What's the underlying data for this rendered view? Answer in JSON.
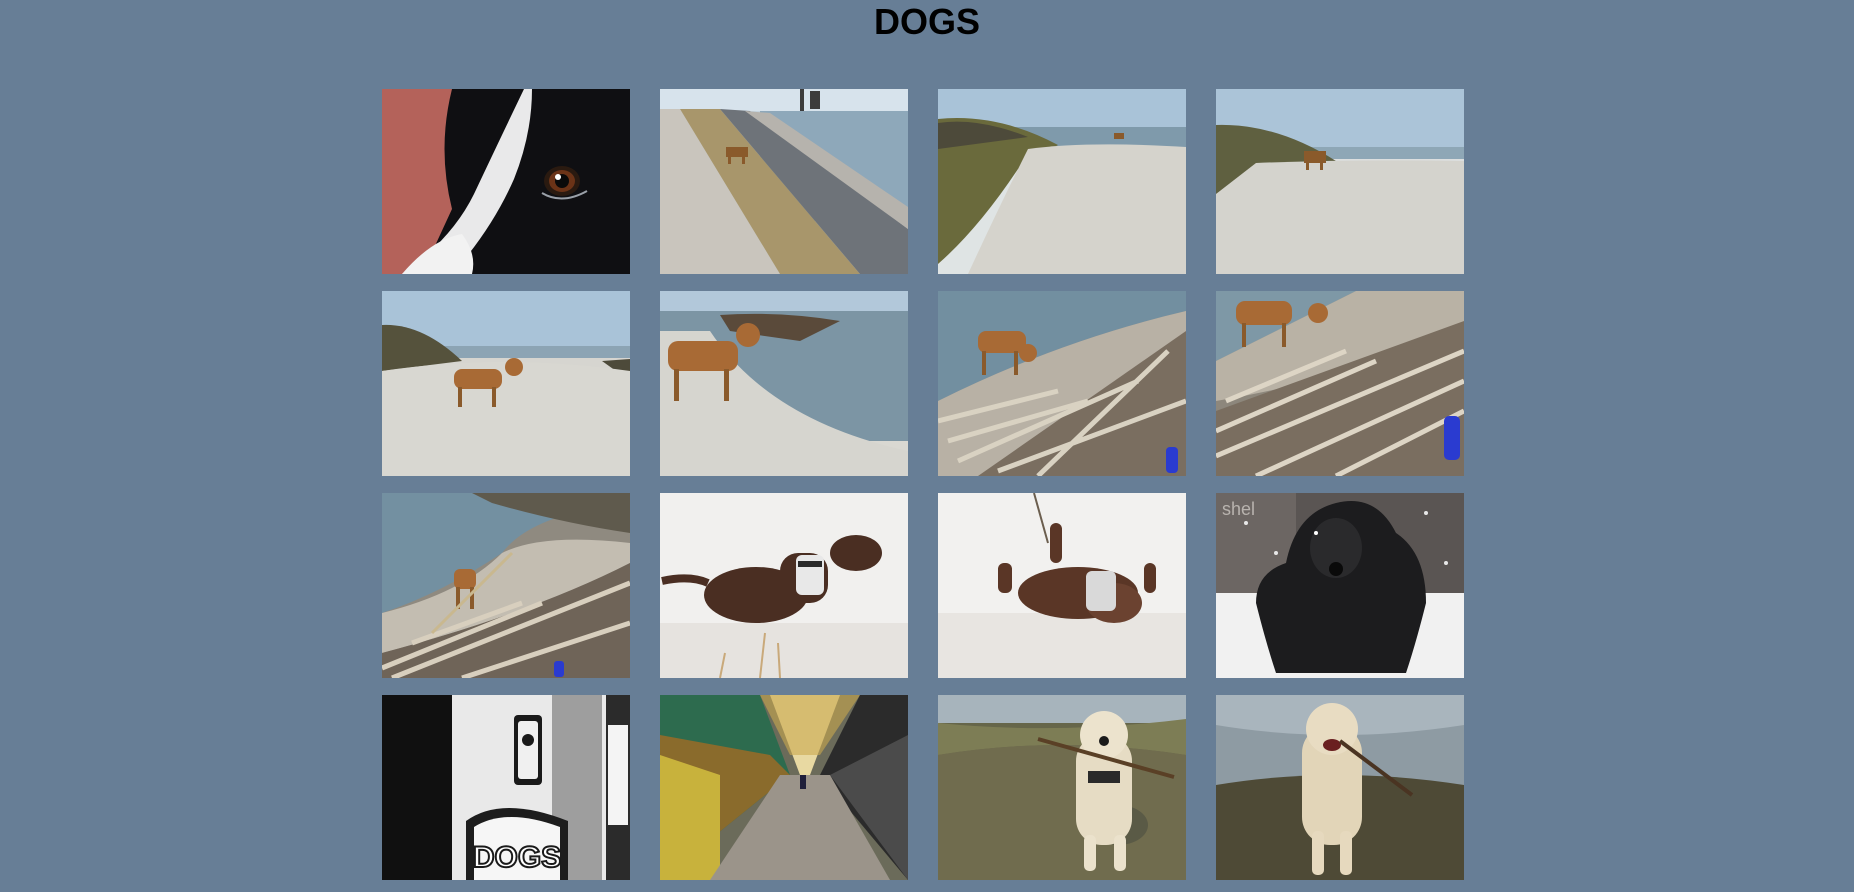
{
  "page": {
    "title": "DOGS",
    "background": "#677e96"
  },
  "gallery": {
    "images": [
      {
        "subject": "border-collie-closeup"
      },
      {
        "subject": "dog-on-seawall-distance"
      },
      {
        "subject": "dog-on-beach-path-far"
      },
      {
        "subject": "dog-on-beach-path-wide"
      },
      {
        "subject": "dog-standing-on-concrete"
      },
      {
        "subject": "dog-by-water-edge"
      },
      {
        "subject": "dog-sniffing-driftwood"
      },
      {
        "subject": "dog-on-driftwood-pile"
      },
      {
        "subject": "dog-with-stick-by-sea"
      },
      {
        "subject": "chocolate-lab-running-snow"
      },
      {
        "subject": "chocolate-lab-rolling-snow"
      },
      {
        "subject": "spaniel-in-snow",
        "overlay_text": "shel"
      },
      {
        "subject": "dogs-pub-sign",
        "sign_text": "DOGS"
      },
      {
        "subject": "covered-market-arcade"
      },
      {
        "subject": "golden-retriever-with-stick"
      },
      {
        "subject": "golden-retriever-running-stick"
      }
    ]
  }
}
